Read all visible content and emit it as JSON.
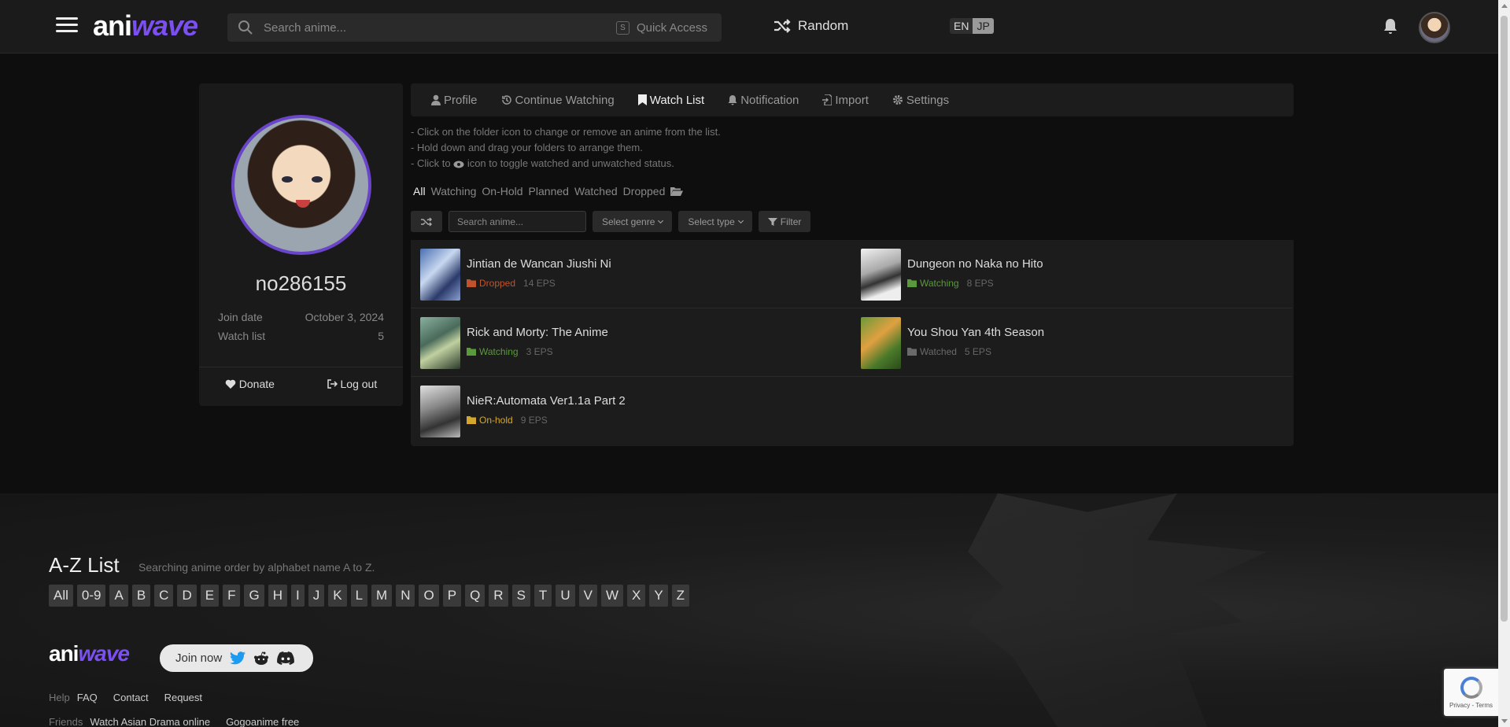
{
  "header": {
    "logo_text_1": "ani",
    "logo_text_2": "wave",
    "search_placeholder": "Search anime...",
    "quick_key": "S",
    "quick_access": "Quick Access",
    "random": "Random",
    "lang_en": "EN",
    "lang_jp": "JP"
  },
  "profile": {
    "username": "no286155",
    "join_label": "Join date",
    "join_value": "October 3, 2024",
    "watch_label": "Watch list",
    "watch_value": "5",
    "donate": "Donate",
    "logout": "Log out"
  },
  "tabs": [
    {
      "label": "Profile",
      "icon": "user-icon"
    },
    {
      "label": "Continue Watching",
      "icon": "history-icon"
    },
    {
      "label": "Watch List",
      "icon": "bookmark-icon"
    },
    {
      "label": "Notification",
      "icon": "bell-icon"
    },
    {
      "label": "Import",
      "icon": "import-icon"
    },
    {
      "label": "Settings",
      "icon": "gear-icon"
    }
  ],
  "hints": {
    "line1": "- Click on the folder icon to change or remove an anime from the list.",
    "line2": "- Hold down and drag your folders to arrange them.",
    "line3_a": "- Click to",
    "line3_b": "icon to toggle watched and unwatched status."
  },
  "folders": [
    "All",
    "Watching",
    "On-Hold",
    "Planned",
    "Watched",
    "Dropped"
  ],
  "toolbar": {
    "search_placeholder": "Search anime...",
    "genre": "Select genre",
    "type": "Select type",
    "filter": "Filter"
  },
  "watchlist": [
    {
      "title": "Jintian de Wancan Jiushi Ni",
      "status": "Dropped",
      "eps": "14 EPS",
      "color": "#c0532b"
    },
    {
      "title": "Dungeon no Naka no Hito",
      "status": "Watching",
      "eps": "8 EPS",
      "color": "#5a9a3a"
    },
    {
      "title": "Rick and Morty: The Anime",
      "status": "Watching",
      "eps": "3 EPS",
      "color": "#5a9a3a"
    },
    {
      "title": "You Shou Yan 4th Season",
      "status": "Watched",
      "eps": "5 EPS",
      "color": "#6a6a6a"
    },
    {
      "title": "NieR:Automata Ver1.1a Part 2",
      "status": "On-hold",
      "eps": "9 EPS",
      "color": "#d4a72c"
    }
  ],
  "footer": {
    "az_title": "A-Z List",
    "az_sub": "Searching anime order by alphabet name A to Z.",
    "letters": [
      "All",
      "0-9",
      "A",
      "B",
      "C",
      "D",
      "E",
      "F",
      "G",
      "H",
      "I",
      "J",
      "K",
      "L",
      "M",
      "N",
      "O",
      "P",
      "Q",
      "R",
      "S",
      "T",
      "U",
      "V",
      "W",
      "X",
      "Y",
      "Z"
    ],
    "join_now": "Join now",
    "help_label": "Help",
    "help_links": [
      "FAQ",
      "Contact",
      "Request"
    ],
    "friends_label": "Friends",
    "friends_links": [
      "Watch Asian Drama online",
      "Gogoanime free"
    ],
    "recaptcha_text": "Privacy - Terms"
  }
}
